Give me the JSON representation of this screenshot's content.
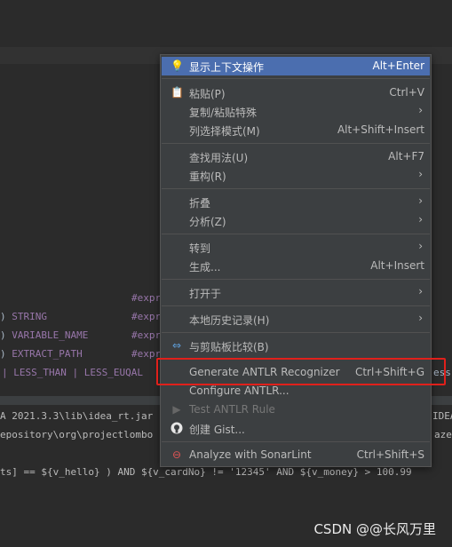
{
  "editor": {
    "lines": [
      {
        "left": "",
        "type": "",
        "right": "#expr"
      },
      {
        "left": ") ",
        "type": "STRING",
        "right": "#expr"
      },
      {
        "left": ") ",
        "type": "VARIABLE_NAME",
        "right": "#expr"
      },
      {
        "left": ") ",
        "type": "EXTRACT_PATH",
        "right": "#expr"
      },
      {
        "left": "| LESS_THAN | LESS_EUQAL",
        "type": "",
        "right": "ess"
      }
    ]
  },
  "console": {
    "lines": [
      "A 2021.3.3\\lib\\idea_rt.jar",
      "epository\\org\\projectlombo",
      "ts] == ${v_hello} ) AND ${v_cardNo} != '12345' AND ${v_money} > 100.99"
    ],
    "right_fragments": [
      "IDEA",
      "aze"
    ]
  },
  "menu": {
    "items": [
      {
        "icon": "💡",
        "label": "显示上下文操作",
        "shortcut": "Alt+Enter"
      },
      {
        "icon": "📋",
        "label": "粘贴(P)",
        "shortcut": "Ctrl+V"
      },
      {
        "icon": "",
        "label": "复制/粘贴特殊",
        "shortcut": "›"
      },
      {
        "icon": "",
        "label": "列选择模式(M)",
        "shortcut": "Alt+Shift+Insert"
      },
      {
        "icon": "",
        "label": "查找用法(U)",
        "shortcut": "Alt+F7"
      },
      {
        "icon": "",
        "label": "重构(R)",
        "shortcut": "›"
      },
      {
        "icon": "",
        "label": "折叠",
        "shortcut": "›"
      },
      {
        "icon": "",
        "label": "分析(Z)",
        "shortcut": "›"
      },
      {
        "icon": "",
        "label": "转到",
        "shortcut": "›"
      },
      {
        "icon": "",
        "label": "生成...",
        "shortcut": "Alt+Insert"
      },
      {
        "icon": "",
        "label": "打开于",
        "shortcut": "›"
      },
      {
        "icon": "",
        "label": "本地历史记录(H)",
        "shortcut": "›"
      },
      {
        "icon": "⇔",
        "label": "与剪贴板比较(B)",
        "shortcut": ""
      },
      {
        "icon": "",
        "label": "Generate ANTLR Recognizer",
        "shortcut": "Ctrl+Shift+G"
      },
      {
        "icon": "",
        "label": "Configure ANTLR...",
        "shortcut": ""
      },
      {
        "icon": "▶",
        "label": "Test ANTLR Rule",
        "shortcut": ""
      },
      {
        "icon": "",
        "label": "创建 Gist...",
        "shortcut": ""
      },
      {
        "icon": "⊖",
        "label": "Analyze with SonarLint",
        "shortcut": "Ctrl+Shift+S"
      }
    ]
  },
  "watermark": "CSDN @@长风万里"
}
